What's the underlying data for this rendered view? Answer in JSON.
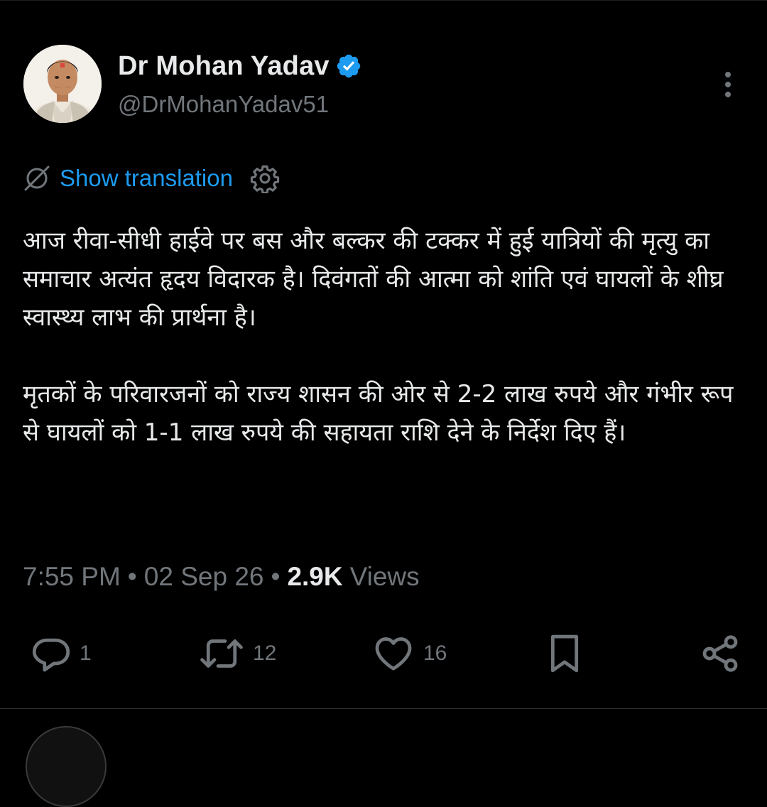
{
  "author": {
    "display_name": "Dr Mohan Yadav",
    "handle": "@DrMohanYadav51",
    "verified": true
  },
  "translation": {
    "label": "Show translation"
  },
  "tweet": {
    "paragraphs": [
      "आज रीवा-सीधी हाईवे पर बस और बल्कर की टक्कर में हुई यात्रियों की मृत्यु का समाचार अत्यंत हृदय विदारक है। दिवंगतों की आत्मा को शांति एवं घायलों के शीघ्र स्वास्थ्य लाभ की प्रार्थना है।",
      "मृतकों के परिवारजनों को राज्य शासन की ओर से 2-2 लाख रुपये और गंभीर रूप से घायलों को 1-1 लाख रुपये की सहायता राशि देने के निर्देश दिए हैं।"
    ],
    "time": "7:55 PM",
    "separator": "•",
    "date": "02 Sep 26",
    "views_count": "2.9K",
    "views_label": "Views"
  },
  "actions": {
    "replies": "1",
    "reposts": "12",
    "likes": "16"
  },
  "icons": {
    "verified": "verified-badge-icon",
    "more": "more-vertical-icon",
    "translate": "globe-slash-icon",
    "settings": "gear-icon",
    "reply": "reply-icon",
    "repost": "repost-icon",
    "like": "heart-icon",
    "bookmark": "bookmark-icon",
    "share": "share-icon"
  },
  "colors": {
    "background": "#000000",
    "text": "#e7e9ea",
    "secondary": "#71767b",
    "accent": "#1d9bf0"
  }
}
